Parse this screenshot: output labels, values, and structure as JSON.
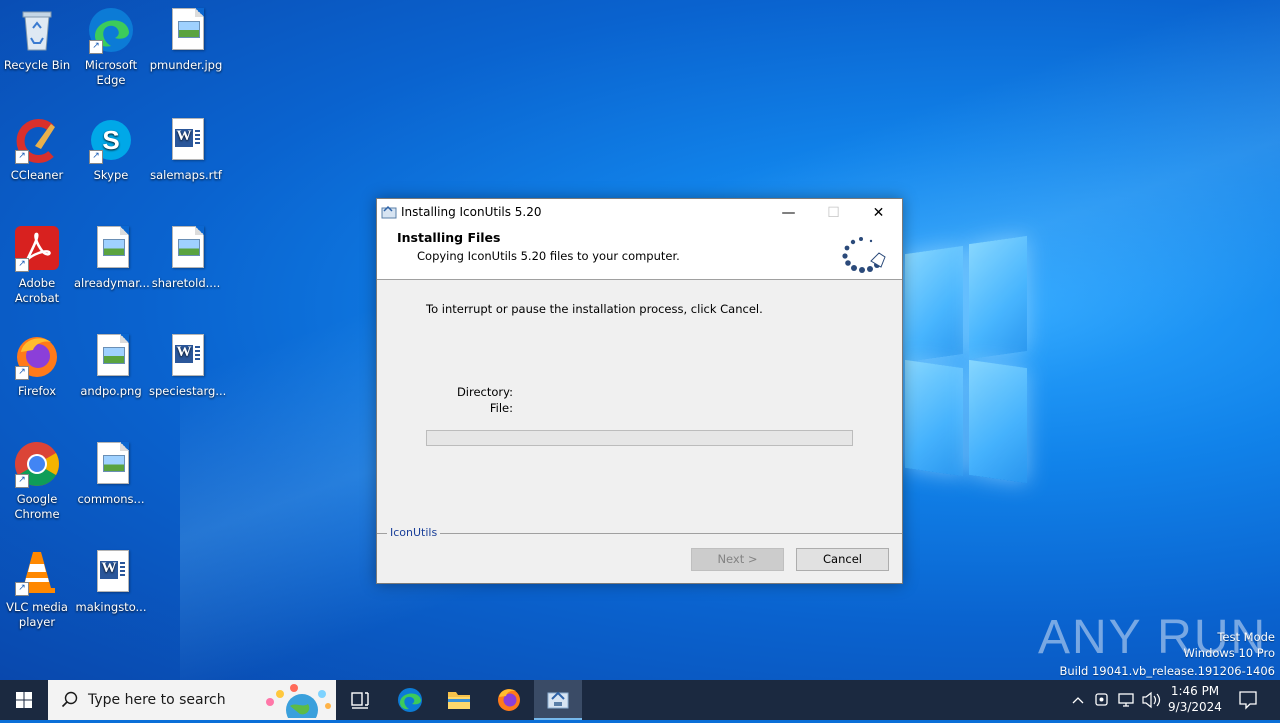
{
  "desktop": {
    "icons": [
      {
        "label": "Recycle Bin"
      },
      {
        "label": "Microsoft Edge"
      },
      {
        "label": "pmunder.jpg"
      },
      {
        "label": "CCleaner"
      },
      {
        "label": "Skype"
      },
      {
        "label": "salemaps.rtf"
      },
      {
        "label": "Adobe Acrobat"
      },
      {
        "label": "alreadymar..."
      },
      {
        "label": "sharetold...."
      },
      {
        "label": "Firefox"
      },
      {
        "label": "andpo.png"
      },
      {
        "label": "speciestarg..."
      },
      {
        "label": "Google Chrome"
      },
      {
        "label": "commons..."
      },
      {
        "label": "VLC media player"
      },
      {
        "label": "makingsto..."
      }
    ]
  },
  "dialog": {
    "title": "Installing IconUtils 5.20",
    "header_title": "Installing Files",
    "header_subtitle": "Copying IconUtils 5.20 files to your computer.",
    "body_text": "To interrupt or pause the installation process, click Cancel.",
    "directory_label": "Directory:",
    "file_label": "File:",
    "progress_fraction": 0,
    "brand": "IconUtils",
    "next_label": "Next >",
    "cancel_label": "Cancel",
    "minimize_glyph": "—",
    "maximize_glyph": "☐",
    "close_glyph": "✕"
  },
  "watermark": {
    "anyrun": "ANY RUN",
    "line1": "Test Mode",
    "line2": "Windows 10 Pro",
    "line3": "Build 19041.vb_release.191206-1406"
  },
  "taskbar": {
    "search_placeholder": "Type here to search",
    "time": "1:46 PM",
    "date": "9/3/2024"
  },
  "colors": {
    "taskbar": "#1b2940",
    "accent": "#76b9ed",
    "brand_text": "#1a3f99"
  }
}
